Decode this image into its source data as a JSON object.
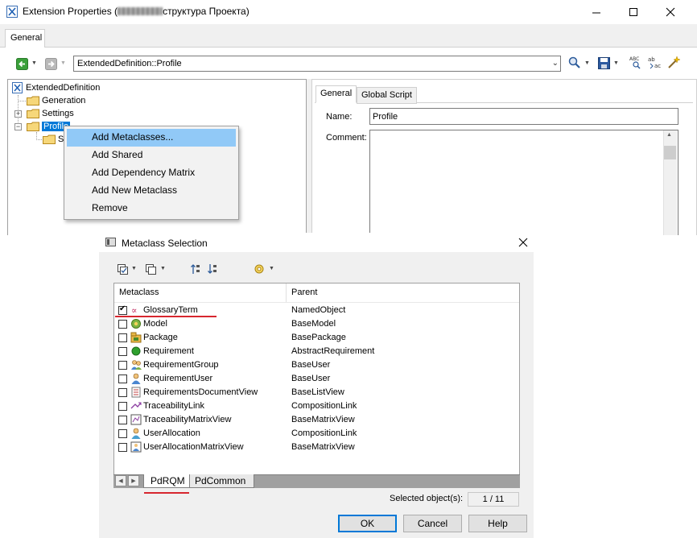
{
  "main_window": {
    "title_prefix": "Extension Properties (",
    "title_suffix": "структура Проекта)",
    "tab_general": "General",
    "path": "ExtendedDefinition::Profile",
    "tree": {
      "root": "ExtendedDefinition",
      "items": [
        "Generation",
        "Settings",
        "Profile"
      ],
      "child_partial": "S"
    },
    "right_tabs": [
      "General",
      "Global Script"
    ],
    "name_label": "Name:",
    "name_value": "Profile",
    "comment_label": "Comment:"
  },
  "context_menu": {
    "items": [
      "Add Metaclasses...",
      "Add Shared",
      "Add Dependency Matrix",
      "Add New Metaclass",
      "Remove"
    ],
    "highlighted_index": 0
  },
  "dialog": {
    "title": "Metaclass Selection",
    "columns": [
      "Metaclass",
      "Parent"
    ],
    "rows": [
      {
        "name": "GlossaryTerm",
        "parent": "NamedObject",
        "checked": true,
        "icon": "glossary-term-icon"
      },
      {
        "name": "Model",
        "parent": "BaseModel",
        "checked": false,
        "icon": "model-icon"
      },
      {
        "name": "Package",
        "parent": "BasePackage",
        "checked": false,
        "icon": "package-icon"
      },
      {
        "name": "Requirement",
        "parent": "AbstractRequirement",
        "checked": false,
        "icon": "requirement-icon"
      },
      {
        "name": "RequirementGroup",
        "parent": "BaseUser",
        "checked": false,
        "icon": "requirement-group-icon"
      },
      {
        "name": "RequirementUser",
        "parent": "BaseUser",
        "checked": false,
        "icon": "requirement-user-icon"
      },
      {
        "name": "RequirementsDocumentView",
        "parent": "BaseListView",
        "checked": false,
        "icon": "document-view-icon"
      },
      {
        "name": "TraceabilityLink",
        "parent": "CompositionLink",
        "checked": false,
        "icon": "traceability-link-icon"
      },
      {
        "name": "TraceabilityMatrixView",
        "parent": "BaseMatrixView",
        "checked": false,
        "icon": "matrix-view-icon"
      },
      {
        "name": "UserAllocation",
        "parent": "CompositionLink",
        "checked": false,
        "icon": "user-allocation-icon"
      },
      {
        "name": "UserAllocationMatrixView",
        "parent": "BaseMatrixView",
        "checked": false,
        "icon": "allocation-matrix-icon"
      }
    ],
    "sheet_tabs": [
      "PdRQM",
      "PdCommon"
    ],
    "selected_label": "Selected object(s):",
    "selected_count": "1 / 11",
    "buttons": {
      "ok": "OK",
      "cancel": "Cancel",
      "help": "Help"
    }
  },
  "colors": {
    "selection": "#0078d7",
    "menu_highlight": "#91c9f7",
    "annotation_red": "#d7262f"
  }
}
